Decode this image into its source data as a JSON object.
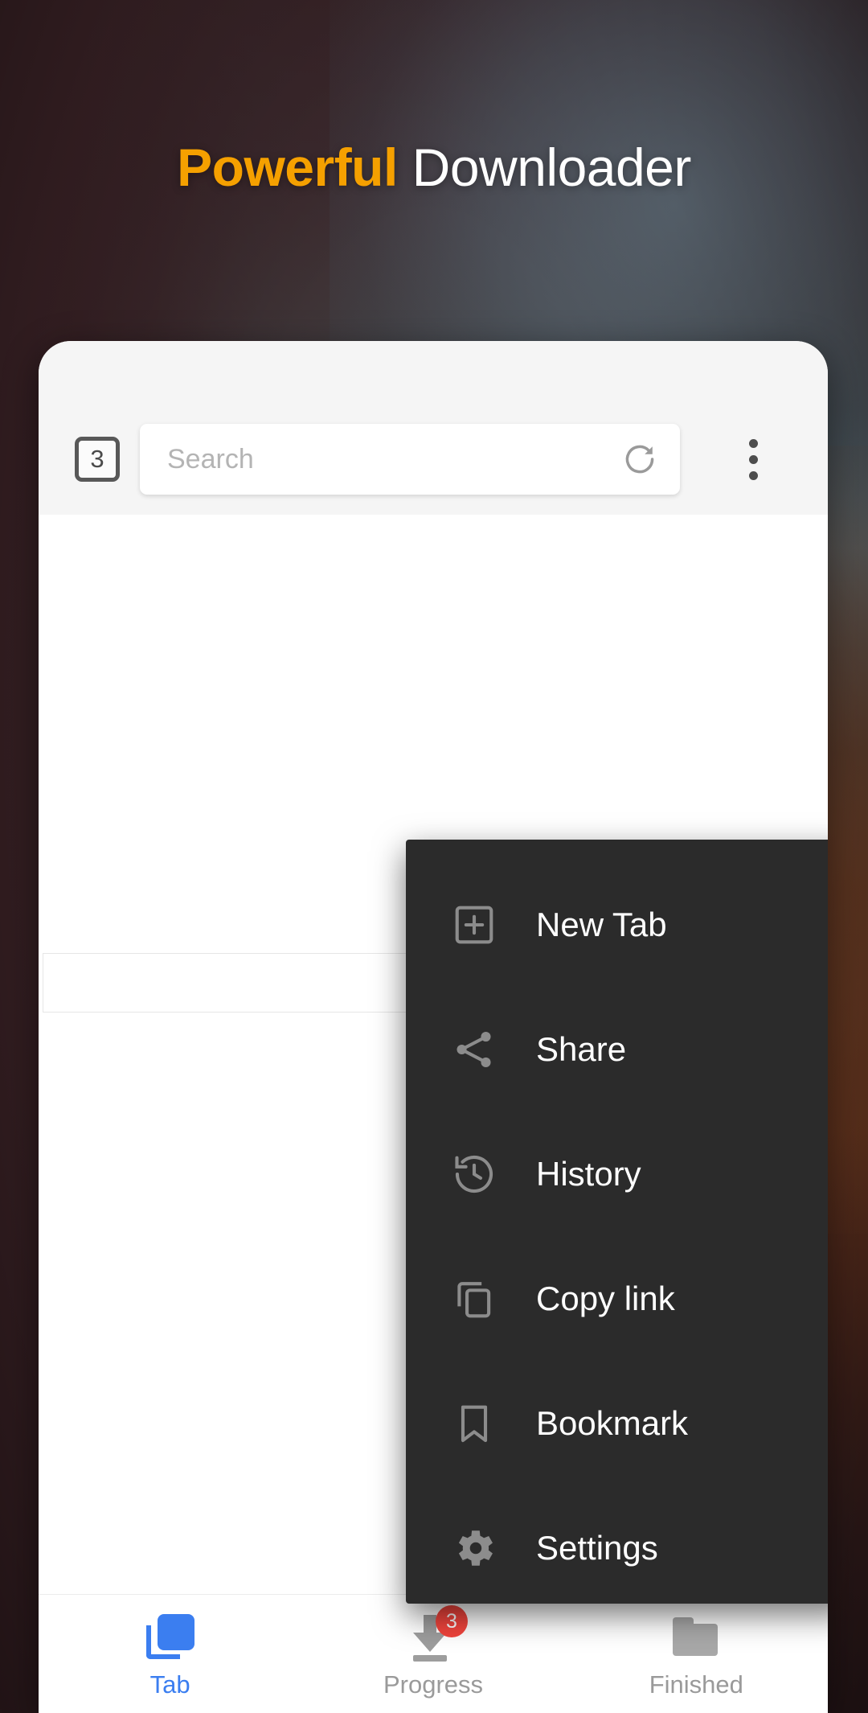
{
  "headline": {
    "accent_text": "Powerful",
    "rest_text": " Downloader",
    "accent_color": "#f5a000",
    "rest_color": "#ffffff"
  },
  "browser": {
    "toolbar": {
      "tab_counter": "3",
      "tab_counter_icon": "tab-count-box-icon",
      "search": {
        "placeholder": "Search",
        "value": ""
      },
      "refresh_icon": "refresh-icon",
      "overflow_icon": "overflow-menu-dots-icon"
    },
    "overflow_menu": {
      "items": [
        {
          "label": "New Tab",
          "icon": "plus-square-icon"
        },
        {
          "label": "Share",
          "icon": "share-icon"
        },
        {
          "label": "History",
          "icon": "history-clock-icon"
        },
        {
          "label": "Copy link",
          "icon": "copy-icon"
        },
        {
          "label": "Bookmark",
          "icon": "bookmark-icon"
        },
        {
          "label": "Settings",
          "icon": "gear-icon"
        }
      ]
    },
    "bottom_nav": {
      "items": [
        {
          "label": "Tab",
          "icon": "layers-icon",
          "active": true,
          "badge": ""
        },
        {
          "label": "Progress",
          "icon": "download-arrow-icon",
          "active": false,
          "badge": "3"
        },
        {
          "label": "Finished",
          "icon": "folder-icon",
          "active": false,
          "badge": ""
        }
      ],
      "active_color": "#3b7ef0",
      "inactive_color": "#9a9a9a",
      "badge_color": "#f2453d"
    }
  }
}
